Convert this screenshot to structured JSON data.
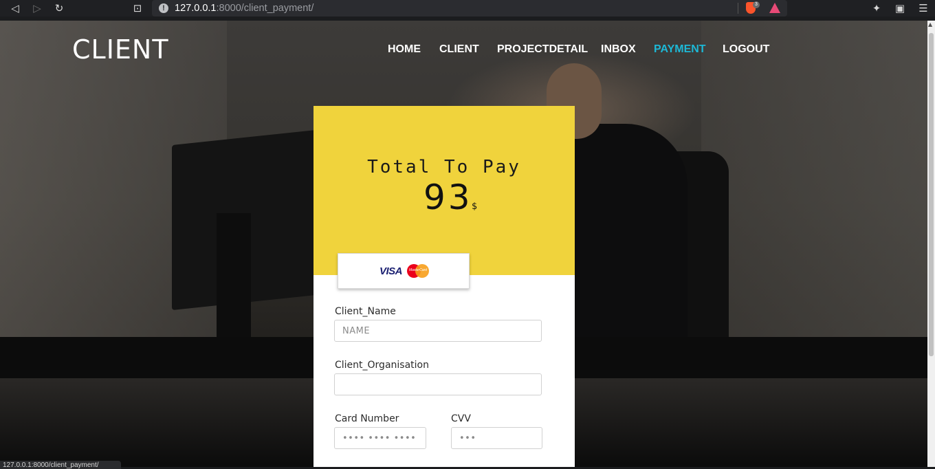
{
  "browser": {
    "url_host": "127.0.0.1",
    "url_path": ":8000/client_payment/",
    "shield_count": "3",
    "back_icon": "arrow-left-icon",
    "forward_icon": "arrow-right-icon",
    "reload_icon": "reload-icon",
    "bookmark_icon": "bookmark-icon",
    "extensions_icon": "puzzle-icon",
    "wallet_icon": "wallet-icon",
    "menu_icon": "hamburger-icon",
    "status_url": "127.0.0.1:8000/client_payment/"
  },
  "navbar": {
    "brand": "CLIENT",
    "items": [
      {
        "label": "HOME",
        "active": false
      },
      {
        "label": "CLIENT",
        "active": false
      },
      {
        "label": "PROJECTDETAIL",
        "active": false
      },
      {
        "label": "INBOX",
        "active": false
      },
      {
        "label": "PAYMENT",
        "active": true
      },
      {
        "label": "LOGOUT",
        "active": false
      }
    ]
  },
  "payment": {
    "total_label": "Total To Pay",
    "amount": "93",
    "currency": "$",
    "card_brands": [
      "VISA",
      "MasterCard"
    ],
    "fields": {
      "client_name": {
        "label": "Client_Name",
        "placeholder": "NAME",
        "value": ""
      },
      "client_org": {
        "label": "Client_Organisation",
        "placeholder": "",
        "value": ""
      },
      "card_number": {
        "label": "Card Number",
        "placeholder": "•••• •••• •••• ••••",
        "value": ""
      },
      "cvv": {
        "label": "CVV",
        "placeholder": "•••",
        "value": ""
      }
    }
  },
  "colors": {
    "accent_active_nav": "#1db8d6",
    "card_header": "#f0d33c"
  }
}
